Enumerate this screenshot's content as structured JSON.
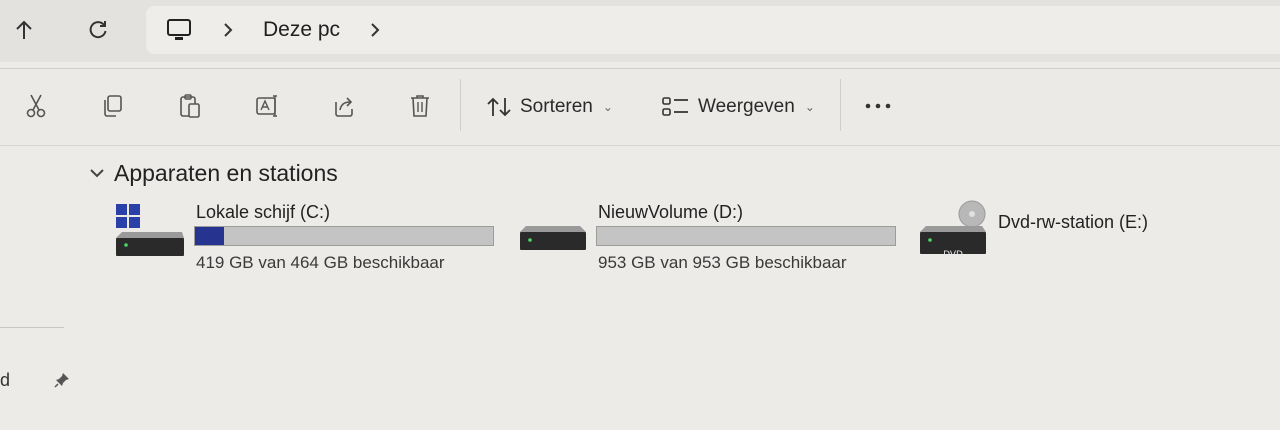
{
  "nav": {
    "up_icon": "arrow-up-icon",
    "refresh_icon": "refresh-icon"
  },
  "address": {
    "computer_icon": "monitor-icon",
    "path": "Deze pc"
  },
  "toolbar": {
    "actions": [
      "cut-icon",
      "copy-icon",
      "paste-icon",
      "rename-icon",
      "share-icon",
      "delete-icon"
    ],
    "sort_label": "Sorteren",
    "view_label": "Weergeven",
    "more_icon": "more-icon"
  },
  "section": {
    "title": "Apparaten en stations"
  },
  "drives": [
    {
      "name": "Lokale schijf (C:)",
      "free_text": "419 GB van 464 GB beschikbaar",
      "used_fraction": 0.097,
      "icon": "windows-drive-icon"
    },
    {
      "name": "NieuwVolume (D:)",
      "free_text": "953 GB van 953 GB beschikbaar",
      "used_fraction": 0.0,
      "icon": "drive-icon"
    },
    {
      "name": "Dvd-rw-station (E:)",
      "badge": "DVD",
      "icon": "dvd-drive-icon"
    }
  ],
  "sidebar": {
    "partial_text": "d"
  },
  "colors": {
    "usage_bar": "#27348f",
    "background": "#ecebe8"
  }
}
